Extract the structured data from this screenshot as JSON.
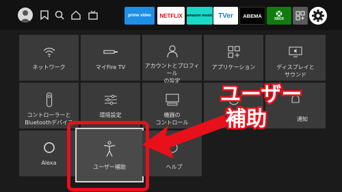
{
  "nav": {
    "icons": [
      "profile-icon",
      "bookmark-icon",
      "search-icon",
      "home-icon",
      "live-tv-icon"
    ]
  },
  "apps": [
    {
      "name": "prime video",
      "bg": "#1f8ee5",
      "fg": "#ffffff"
    },
    {
      "name": "NETFLIX",
      "bg": "#ffffff",
      "fg": "#e50914"
    },
    {
      "name": "amazon music",
      "bg": "#1ad9c6",
      "fg": "#0b0b0b"
    },
    {
      "name": "TVer",
      "bg": "#ffffff",
      "fg": "#1b78c9"
    },
    {
      "name": "ABEMA",
      "bg": "#000000",
      "fg": "#ffffff"
    },
    {
      "name": "XBOX",
      "bg": "#107c10",
      "fg": "#ffffff"
    }
  ],
  "settings": [
    {
      "label": "ネットワーク",
      "icon": "wifi-icon"
    },
    {
      "label": "マイFire TV",
      "icon": "fire-tv-stick-icon"
    },
    {
      "label": "アカウントとプロフィール\nの設定",
      "icon": "account-icon"
    },
    {
      "label": "アプリケーション",
      "icon": "apps-grid-icon"
    },
    {
      "label": "ディスプレイと\nサウンド",
      "icon": "display-sound-icon"
    },
    {
      "label": "コントローラーと\nBluetoothデバイス",
      "icon": "remote-controller-icon"
    },
    {
      "label": "環境設定",
      "icon": "sliders-icon"
    },
    {
      "label": "機器の\nコントロール",
      "icon": "tv-equipment-icon"
    },
    {
      "label": "",
      "icon": "notification-icon"
    },
    {
      "label": "通知",
      "icon": "bell-icon"
    },
    {
      "label": "Alexa",
      "icon": "alexa-icon"
    },
    {
      "label": "ユーザー補助",
      "icon": "accessibility-icon"
    },
    {
      "label": "ヘルプ",
      "icon": "help-icon"
    }
  ],
  "annotation": {
    "line1": "ユーザー",
    "line2": "補助",
    "color": "#e8101b"
  }
}
